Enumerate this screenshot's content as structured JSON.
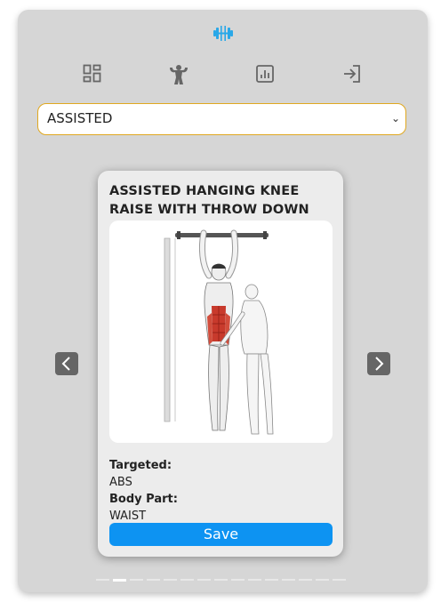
{
  "app": {
    "logo_icon": "dumbbell-icon",
    "accent_color": "#0d93f2",
    "logo_color": "#29a8e8"
  },
  "nav": {
    "items": [
      {
        "icon": "dashboard-icon"
      },
      {
        "icon": "bodybuilder-icon"
      },
      {
        "icon": "chart-icon"
      },
      {
        "icon": "login-icon"
      }
    ]
  },
  "filter": {
    "selected": "ASSISTED"
  },
  "carousel": {
    "prev_icon": "chevron-left-icon",
    "next_icon": "chevron-right-icon",
    "slide_count": 15,
    "active_index": 1
  },
  "card": {
    "title": "ASSISTED HANGING KNEE RAISE WITH THROW DOWN",
    "targeted_label": "Targeted:",
    "targeted_value": "ABS",
    "body_part_label": "Body Part:",
    "body_part_value": "WAIST",
    "save_label": "Save"
  }
}
